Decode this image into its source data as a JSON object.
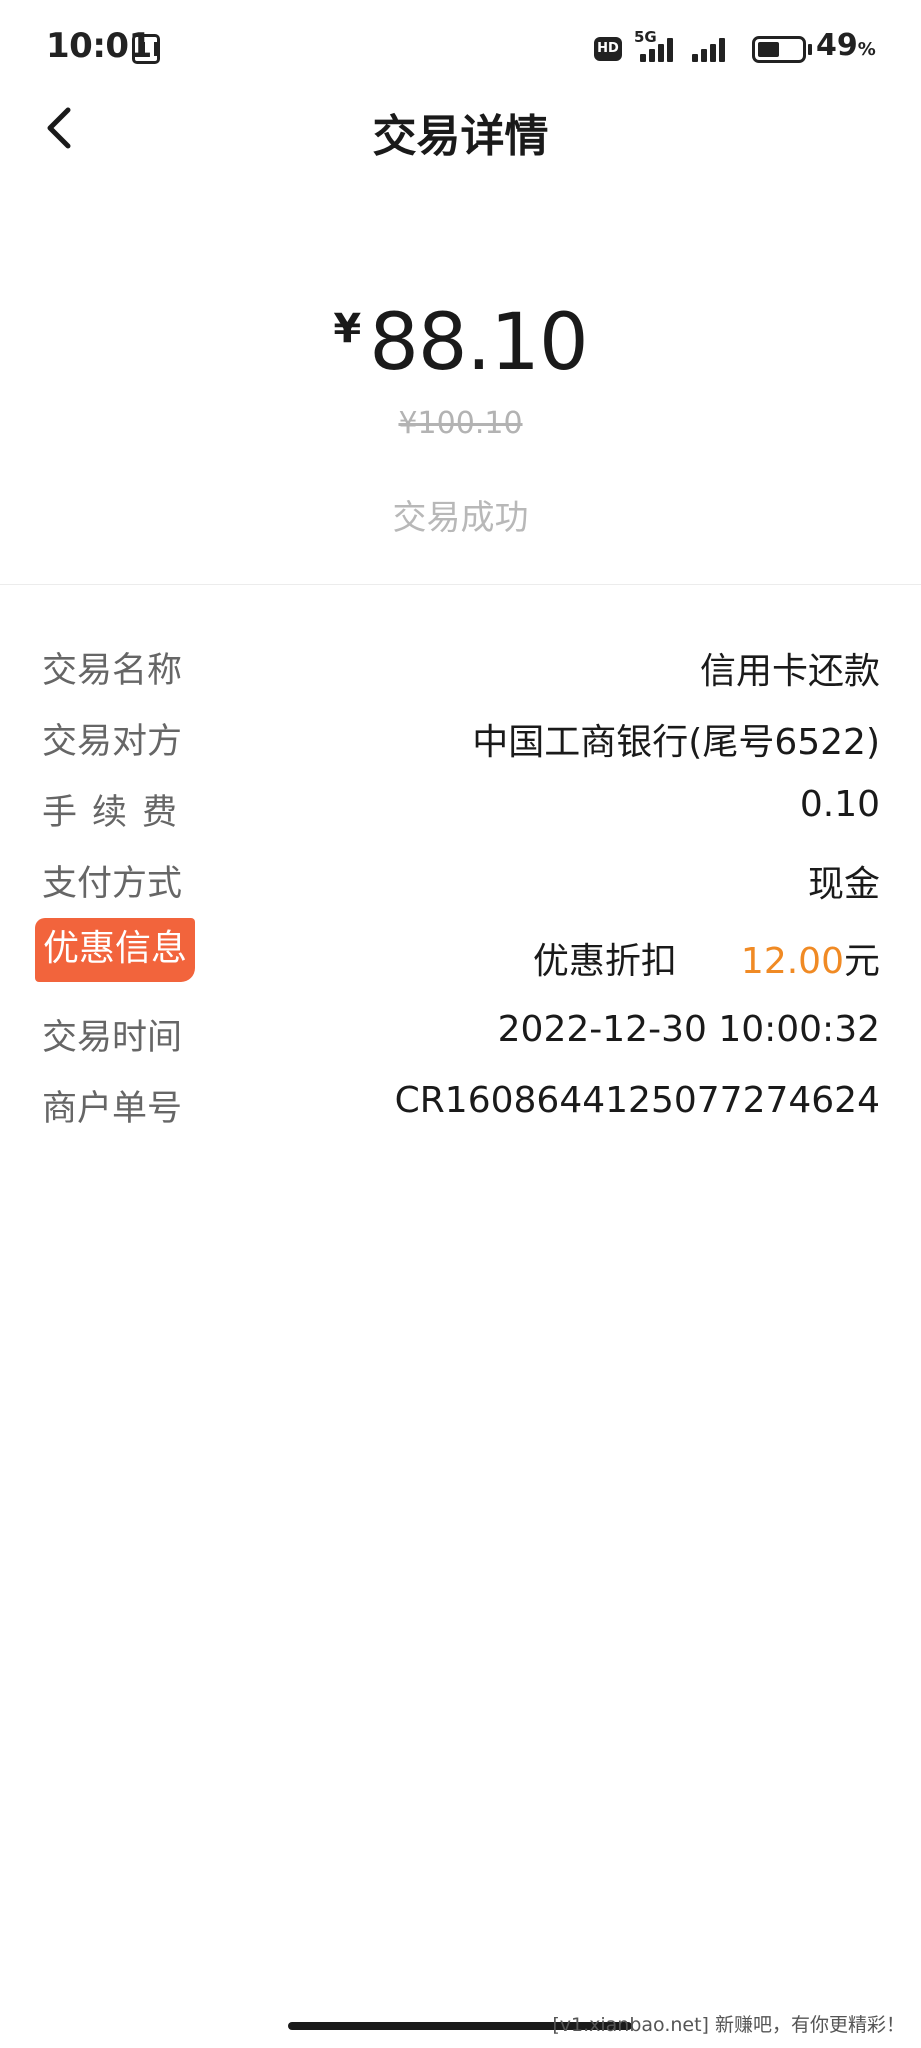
{
  "status_bar": {
    "time": "10:01",
    "hd_label": "HD",
    "network_label": "5G",
    "battery_percent": "49",
    "battery_unit": "%",
    "battery_level": 0.49,
    "signal_bars": [
      4,
      4
    ]
  },
  "header": {
    "back_icon": "chevron-left-icon",
    "title": "交易详情"
  },
  "summary": {
    "currency_symbol": "¥",
    "amount": "88.10",
    "original_amount": "¥100.10",
    "status": "交易成功"
  },
  "details": {
    "trade_name_label": "交易名称",
    "trade_name_value": "信用卡还款",
    "counterparty_label": "交易对方",
    "counterparty_value": "中国工商银行(尾号6522)",
    "fee_label": "手续费",
    "fee_value": "0.10",
    "payment_method_label": "支付方式",
    "payment_method_value": "现金",
    "promo_label": "优惠信息",
    "promo_name": "优惠折扣",
    "promo_amount": "12.00",
    "promo_unit": "元",
    "trade_time_label": "交易时间",
    "trade_time_value": "2022-12-30 10:00:32",
    "merchant_order_label": "商户单号",
    "merchant_order_value": "CR1608644125077274624"
  },
  "watermark": {
    "text": "[v1.xianbao.net] 新赚吧，有你更精彩！"
  },
  "colors": {
    "promo_badge": "#f2643c",
    "promo_amount": "#f08a24",
    "label_gray": "#666666",
    "muted_gray": "#b8b8b8"
  }
}
